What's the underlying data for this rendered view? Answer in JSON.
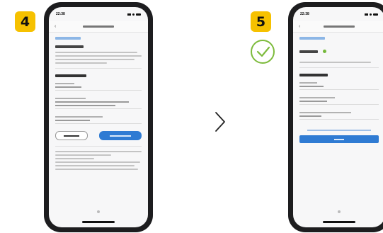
{
  "steps": {
    "left": "4",
    "right": "5"
  },
  "colors": {
    "badge": "#f6c100",
    "success": "#7dbb3c",
    "primary": "#2f7bd3"
  },
  "icons": {
    "success": "check-circle-icon",
    "next": "chevron-right-icon"
  },
  "phone1": {
    "time": "22:38"
  },
  "phone2": {
    "time": "22:38"
  }
}
